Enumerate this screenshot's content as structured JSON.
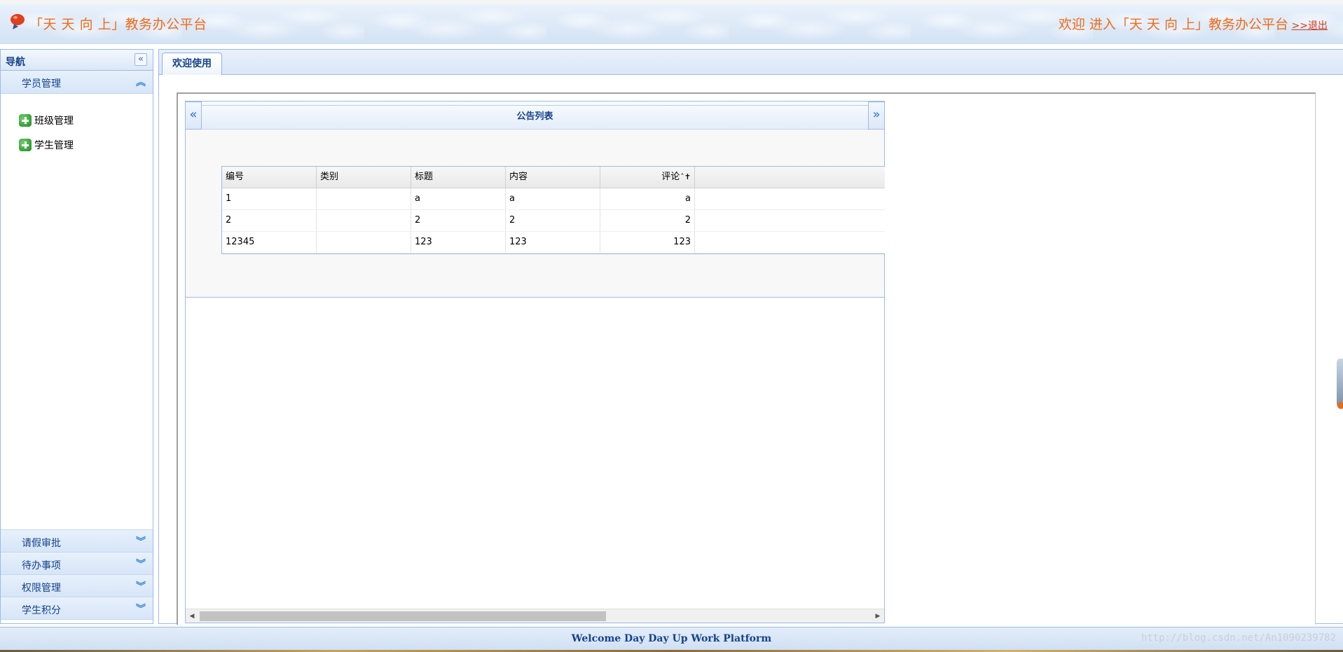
{
  "header": {
    "app_title": "「天 天 向 上」教务办公平台",
    "welcome_text": "欢迎 进入「天 天 向 上」教务办公平台",
    "logout_label": ">>退出"
  },
  "sidebar": {
    "title": "导航",
    "collapse_icon": "double-chevron-left-icon",
    "sections": [
      {
        "label": "学员管理",
        "expanded": true,
        "items": [
          {
            "label": "班级管理",
            "icon": "green-plus-icon"
          },
          {
            "label": "学生管理",
            "icon": "green-plus-icon"
          }
        ]
      },
      {
        "label": "请假审批",
        "expanded": false
      },
      {
        "label": "待办事项",
        "expanded": false
      },
      {
        "label": "权限管理",
        "expanded": false
      },
      {
        "label": "学生积分",
        "expanded": false
      }
    ]
  },
  "tabs": [
    {
      "label": "欢迎使用",
      "active": true
    }
  ],
  "panel": {
    "title": "公告列表",
    "prev_icon": "double-chevron-left-icon",
    "next_icon": "double-chevron-right-icon"
  },
  "grid": {
    "columns": [
      "编号",
      "类别",
      "标题",
      "内容",
      "评论"
    ],
    "rows": [
      [
        "1",
        "",
        "a",
        "a",
        "a"
      ],
      [
        "2",
        "",
        "2",
        "2",
        "2"
      ],
      [
        "12345",
        "",
        "123",
        "123",
        "123"
      ]
    ]
  },
  "footer": {
    "text": "Welcome Day Day Up Work Platform",
    "watermark": "http://blog.csdn.net/An1090239782"
  },
  "colors": {
    "title_orange": "#f26a18",
    "nav_blue": "#15428b",
    "border_blue": "#99bbe8"
  }
}
